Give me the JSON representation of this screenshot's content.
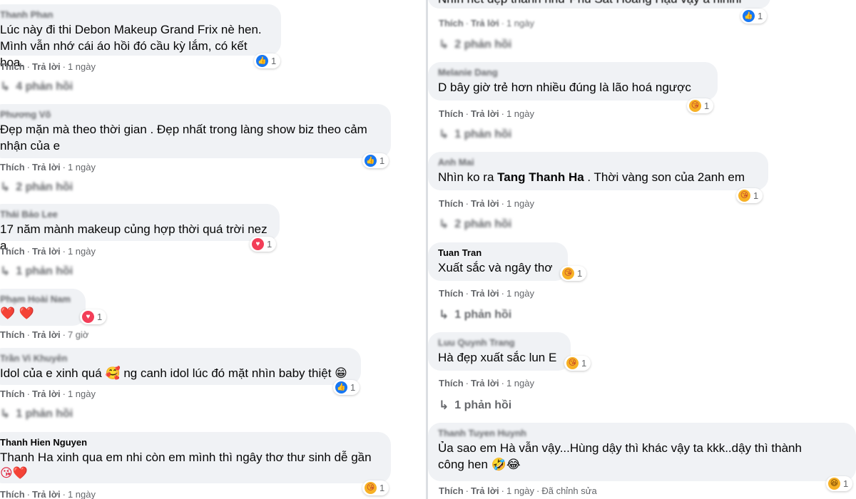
{
  "labels": {
    "like": "Thích",
    "reply": "Trả lời",
    "sep": "·",
    "edited": "Đã chỉnh sửa"
  },
  "left": [
    {
      "author": "Thanh Phan",
      "lines": [
        "Lúc này đi thi Debon Makeup Grand Frix nè hen.",
        "Mình vẫn nhớ cái áo hồi đó cầu kỳ lắm, có kết hoa."
      ],
      "reaction": {
        "icon": "like-icon",
        "count": "1"
      },
      "time": "1 ngày",
      "replies": "4 phản hồi"
    },
    {
      "author": "Phương Võ",
      "lines": [
        "Đẹp mặn mà theo thời gian . Đẹp nhất trong làng show biz theo cảm",
        "nhận của e"
      ],
      "reaction": {
        "icon": "like-icon",
        "count": "1"
      },
      "time": "1 ngày",
      "replies": "2 phản hồi"
    },
    {
      "author": "Thái Bảo Lee",
      "lines": [
        "17 năm mành makeup củng hợp thời quá trời nez a"
      ],
      "reaction": {
        "icon": "love-icon",
        "count": "1"
      },
      "time": "1 ngày",
      "replies": "1 phản hồi"
    },
    {
      "author": "Phạm Hoài Nam",
      "lines": [
        "❤️ ❤️"
      ],
      "reaction": {
        "icon": "love-icon",
        "count": "1"
      },
      "time": "7 giờ",
      "replies": ""
    },
    {
      "author": "Trần Vi Khuyên",
      "lines": [
        "Idol của e xinh quá 🥰 ng canh idol lúc đó mặt nhìn baby thiệt 😁"
      ],
      "reaction": {
        "icon": "like-icon",
        "count": "1"
      },
      "time": "1 ngày",
      "replies": "1 phản hồi"
    },
    {
      "author": "Thanh Hien Nguyen",
      "lines": [
        "Thanh Ha xinh qua em nhi còn em mình thì ngây thơ thư sinh dễ gần",
        "😘❤️"
      ],
      "reaction": {
        "icon": "care-icon",
        "count": "1"
      },
      "time": "1 ngày",
      "replies": ""
    }
  ],
  "right": [
    {
      "author": "",
      "lines": [
        "Nhìn nét đẹp thanh như Phú Sát Hoàng Hậu vậy á hihihi"
      ],
      "reaction": {
        "icon": "like-icon",
        "count": "1"
      },
      "time": "1 ngày",
      "replies": "2 phản hồi"
    },
    {
      "author": "Melanie Dang",
      "lines": [
        "D bây giờ trẻ hơn nhiều đúng là lão hoá ngược"
      ],
      "reaction": {
        "icon": "care-icon",
        "count": "1"
      },
      "time": "1 ngày",
      "replies": "1 phản hồi"
    },
    {
      "author": "Anh Mai",
      "line_pre": "Nhìn ko ra ",
      "mention": "Tang Thanh Ha",
      "line_post": " . Thời vàng son của 2anh em",
      "reaction": {
        "icon": "care-icon",
        "count": "1"
      },
      "time": "1 ngày",
      "replies": "2 phản hồi"
    },
    {
      "author": "Tuan Tran",
      "lines": [
        "Xuất sắc và ngây thơ"
      ],
      "reaction": {
        "icon": "care-icon",
        "count": "1"
      },
      "time": "1 ngày",
      "replies": "1 phản hồi"
    },
    {
      "author": "Luu Quynh Trang",
      "lines": [
        "Hà đẹp xuất sắc lun E"
      ],
      "reaction": {
        "icon": "care-icon",
        "count": "1"
      },
      "time": "1 ngày",
      "replies": "1 phản hồi"
    },
    {
      "author": "Thanh Tuyen Huynh",
      "lines": [
        "Ủa sao em Hà vẫn vậy...Hùng dậy thì khác vậy ta kkk..dậy thì thành",
        "công hen 🤣😂"
      ],
      "reaction": {
        "icon": "haha-icon",
        "count": "1"
      },
      "time": "1 ngày",
      "replies": ""
    }
  ]
}
